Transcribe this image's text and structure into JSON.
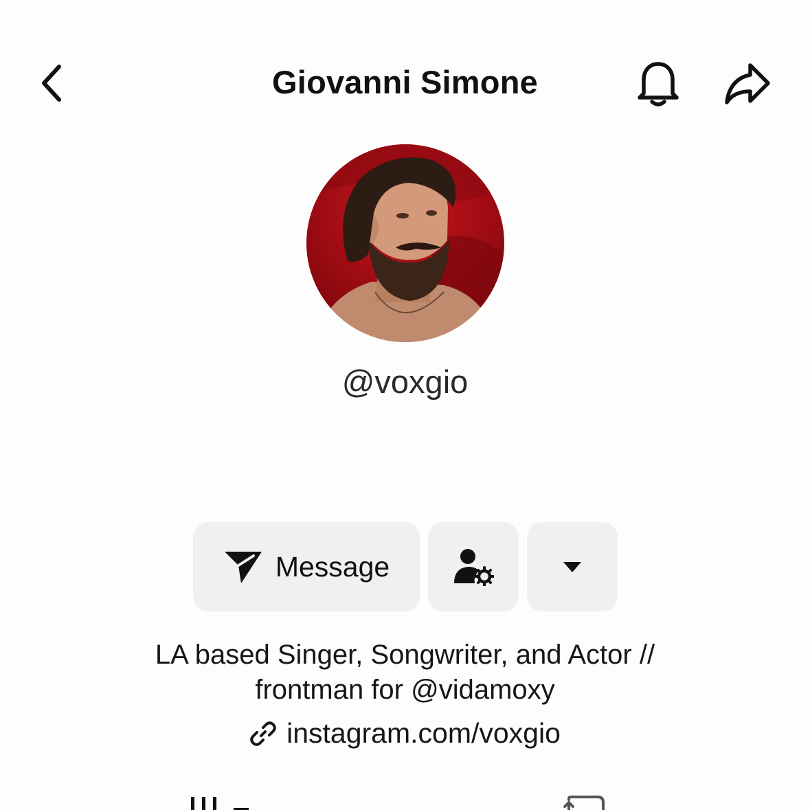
{
  "header": {
    "title": "Giovanni Simone",
    "back_icon": "chevron-left-icon",
    "notification_icon": "bell-icon",
    "share_icon": "share-arrow-icon"
  },
  "profile": {
    "avatar_alt": "profile photo",
    "username": "@voxgio"
  },
  "actions": {
    "message_label": "Message",
    "message_icon": "send-icon",
    "friend_icon": "user-settings-icon",
    "more_icon": "caret-down-icon"
  },
  "bio": {
    "line1": "LA based Singer, Songwriter, and Actor //",
    "line2": "frontman for @vidamoxy",
    "link": "instagram.com/voxgio",
    "link_icon": "link-icon"
  },
  "tabs": {
    "items": [
      "videos-grid-icon",
      "reposts-icon"
    ]
  },
  "colors": {
    "background": "#fdfdfd",
    "button_bg": "#f0f0f2",
    "text": "#161823",
    "avatar_bg": "#b0111a"
  }
}
